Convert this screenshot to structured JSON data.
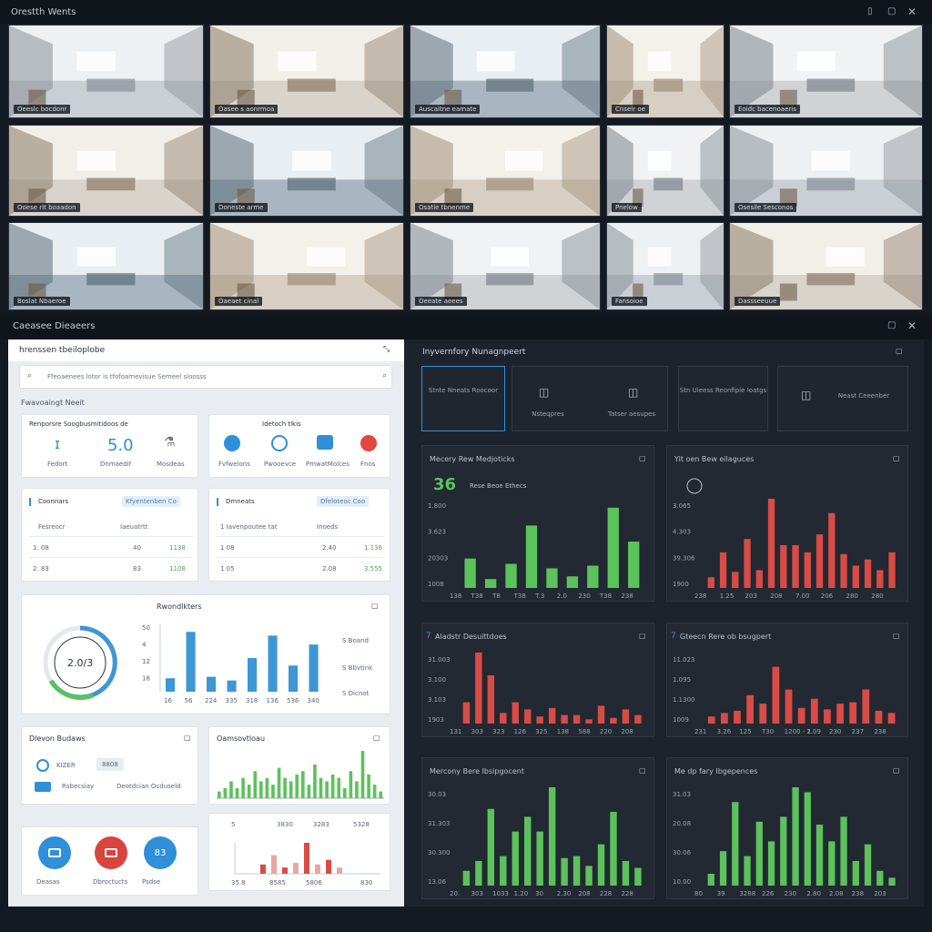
{
  "top": {
    "title": "Orestth Wents"
  },
  "cams": [
    {
      "label": "Oeeslc bocdonr"
    },
    {
      "label": "Oasee s aonrmoa"
    },
    {
      "label": "Auscaitne eamate"
    },
    {
      "label": "Cnselr oe"
    },
    {
      "label": "Eoidc bacenoaeris"
    },
    {
      "label": "Ooese rlt boaadon"
    },
    {
      "label": "Doneste arme"
    },
    {
      "label": "Osatie tbnenme"
    },
    {
      "label": "Pnelow"
    },
    {
      "label": "Osesile Sesconos"
    },
    {
      "label": "Boslat Nbaeroe"
    },
    {
      "label": "Oaeaet cinal"
    },
    {
      "label": "Oeeate aeees"
    },
    {
      "label": "Fansoioe"
    },
    {
      "label": "Dassseeuue"
    }
  ],
  "section2": {
    "title": "Caeasee Dieaeers"
  },
  "left": {
    "title": "hrenssen tbeiloplobe",
    "search_placeholder": "Ffeoaenees lotor is tfofoamevisue Semeel sloosss",
    "subhead": "Fwavoaingt Neeit",
    "card1": {
      "title": "Renporsre Soogbusmitidoos de",
      "value": "5.0",
      "labels": [
        "Fedort",
        "Dnmaedif",
        "Mosdeas"
      ]
    },
    "card2": {
      "title": "Idetoch tlkis",
      "labels": [
        "Fvfwelons",
        "Pwooevce",
        "PmwatMolces",
        "Fnos"
      ]
    },
    "table1": {
      "title": "Coonnars",
      "tag": "Kfyentenben  Co",
      "cols": [
        "Fesreocr",
        "Iaeuatrtt"
      ],
      "rows": [
        [
          "1.  08",
          "40",
          "1138"
        ],
        [
          "2.  83",
          "83",
          "1108"
        ]
      ]
    },
    "table2": {
      "title": "Dmneats",
      "tag": "Dfeloteoc  Coo",
      "cols": [
        "1  Iavenpoutee tat",
        "Inoeds"
      ],
      "rows": [
        [
          "1   08",
          "2.40",
          "1.136"
        ],
        [
          "1   05",
          "2.08",
          "3.555"
        ]
      ]
    },
    "gauge_card": {
      "title": "Rwondlkters",
      "gauge_value": "2.0/3",
      "legend": [
        "S Boand",
        "S Bbvtink",
        "S Dicnot"
      ]
    },
    "bar_chart": {
      "type": "bar",
      "categories": [
        "16",
        "56",
        "224",
        "335",
        "318",
        "136",
        "536",
        "340"
      ],
      "values": [
        1.8,
        8.0,
        2.0,
        1.5,
        4.5,
        7.5,
        3.5,
        6.3
      ],
      "yticks": [
        "50",
        "4",
        "12",
        "18"
      ],
      "color": "#3d97d6"
    },
    "devices_card": {
      "title": "Dlevon Budaws",
      "items": [
        {
          "a": "KIZER",
          "b": "8808"
        },
        {
          "a": "Rsbecsiay",
          "b": "Deotdcian Ocduseld"
        }
      ]
    },
    "green_card": {
      "title": "Oamsovtloau",
      "values": [
        2,
        3,
        5,
        3,
        6,
        4,
        8,
        5,
        6,
        4,
        9,
        6,
        5,
        7,
        8,
        4,
        10,
        6,
        5,
        7,
        6,
        3,
        8,
        5,
        14,
        7,
        4,
        2
      ],
      "color": "#5cc25b"
    },
    "mini_chart": {
      "type": "bar",
      "top_labels": [
        "5",
        "3830",
        "3283",
        "5328"
      ],
      "values": [
        0.3,
        0.6,
        0.2,
        0.35,
        1.0,
        0.3,
        0.45,
        0.2
      ],
      "xticks": [
        "35.8",
        "8585",
        "5806",
        "830"
      ],
      "color": "#d94b45"
    },
    "bottom_icons": [
      {
        "label": "Deasas",
        "color": "#2f8fd8"
      },
      {
        "label": "Dbroctucts",
        "color": "#d9443f"
      },
      {
        "label": "Psdse",
        "color": "#2f8fd8",
        "text": "83"
      }
    ]
  },
  "right": {
    "title": "Inyvernfory Nunagnpeert",
    "tiles": [
      "Stnte Nneats Roocoor",
      "Nsteqpres",
      "Tatser aesupes",
      "Stn Uieess Reonfipie Ioatgs",
      "Neast Ceeenber"
    ],
    "charts": [
      {
        "type": "bar",
        "title": "Mecery Rew Medjoticks",
        "highlight": "36",
        "highlight_label": "Rese Beoe Ethecs",
        "yticks": [
          "1.800",
          "3.623",
          "20303",
          "1008"
        ],
        "xticks": [
          "138",
          "T38",
          "T8",
          "T38",
          "T.3",
          "2.0",
          "230",
          "T38",
          "238"
        ],
        "values": [
          33,
          10,
          27,
          70,
          22,
          13,
          25,
          90,
          52
        ],
        "ylim": [
          0,
          100
        ],
        "color": "#5cc25b"
      },
      {
        "type": "bar",
        "title": "Yit oen Bew eilaguces",
        "yticks": [
          "3.065",
          "4.303",
          "39.306",
          "1900"
        ],
        "xticks": [
          "238",
          "1.25",
          "203",
          "208",
          "7.00",
          "206",
          "280",
          "280"
        ],
        "values": [
          12,
          40,
          18,
          55,
          20,
          100,
          48,
          48,
          40,
          60,
          84,
          38,
          25,
          32,
          20,
          40
        ],
        "ylim": [
          0,
          100
        ],
        "color": "#d94b45"
      },
      {
        "type": "bar",
        "title": "Aladstr Desuittdoes",
        "title_mark": "7",
        "yticks": [
          "31.003",
          "3.100",
          "3.103",
          "1903"
        ],
        "xticks": [
          "131",
          "303",
          "323",
          "126",
          "325",
          "138",
          "588",
          "220",
          "208"
        ],
        "values": [
          30,
          100,
          68,
          15,
          30,
          20,
          10,
          22,
          12,
          12,
          6,
          25,
          8,
          20,
          12
        ],
        "ylim": [
          0,
          100
        ],
        "color": "#d94b45"
      },
      {
        "type": "bar",
        "title": "Gteecn Rere ob bsugpert",
        "title_mark": "7",
        "yticks": [
          "11.023",
          "1.095",
          "1.1300",
          "1009"
        ],
        "xticks": [
          "231",
          "3.26",
          "125",
          "T30",
          "1200 - 1",
          "2.09",
          "230",
          "237",
          "238"
        ],
        "values": [
          10,
          15,
          18,
          40,
          28,
          80,
          48,
          22,
          35,
          20,
          28,
          30,
          48,
          18,
          15
        ],
        "ylim": [
          0,
          100
        ],
        "color": "#d94b45"
      },
      {
        "type": "bar",
        "title": "Mercony Bere Ibsipgocent",
        "yticks": [
          "30.03",
          "31.303",
          "30.300",
          "13.06"
        ],
        "xticks": [
          "20.",
          "303",
          "1033",
          "1.20",
          "30",
          "2.30",
          "208",
          "228",
          "228"
        ],
        "values": [
          15,
          25,
          78,
          30,
          55,
          70,
          55,
          100,
          28,
          30,
          20,
          42,
          75,
          25,
          18
        ],
        "ylim": [
          0,
          100
        ],
        "color": "#5cc25b"
      },
      {
        "type": "bar",
        "title": "Me dp fary Ibgepences",
        "yticks": [
          "31.03",
          "20.08",
          "30.06",
          "10.00"
        ],
        "xticks": [
          "80",
          "39",
          "3288",
          "226",
          "230",
          "2.80",
          "2.08",
          "238",
          "203"
        ],
        "values": [
          12,
          35,
          85,
          30,
          65,
          45,
          70,
          100,
          95,
          62,
          45,
          70,
          25,
          42,
          15,
          8
        ],
        "ylim": [
          0,
          100
        ],
        "color": "#5cc25b"
      }
    ]
  }
}
